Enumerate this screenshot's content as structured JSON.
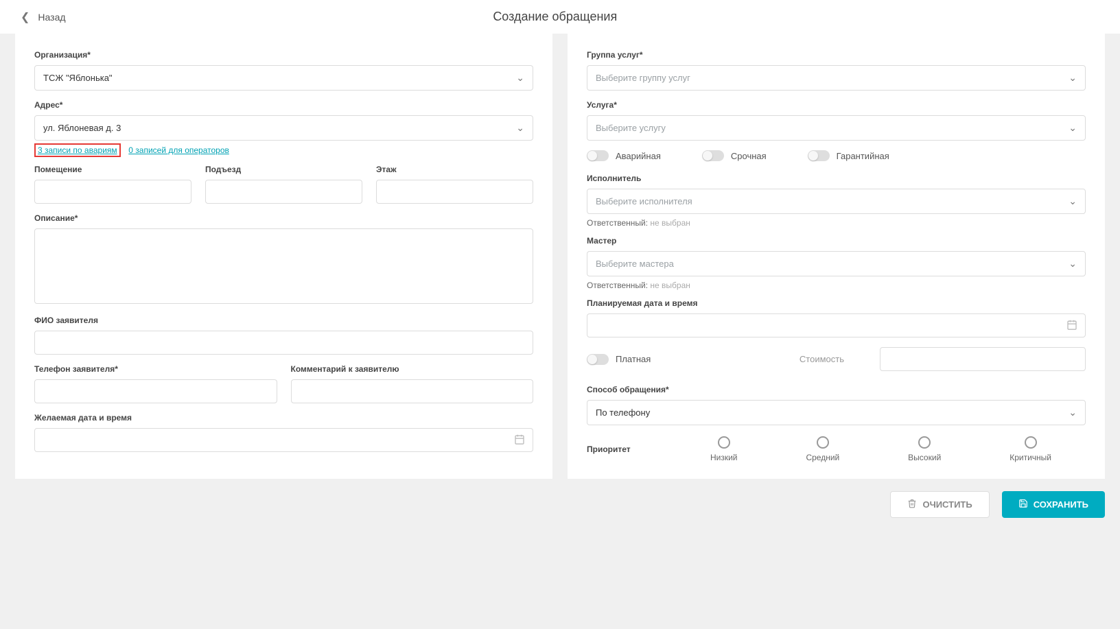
{
  "header": {
    "back": "Назад",
    "title": "Создание обращения"
  },
  "left": {
    "org_label": "Организация*",
    "org_value": "ТСЖ \"Яблонька\"",
    "addr_label": "Адрес*",
    "addr_value": "ул. Яблоневая д. 3",
    "link_accidents": "3 записи по авариям",
    "link_operators": "0 записей для операторов",
    "room_label": "Помещение",
    "entrance_label": "Подъезд",
    "floor_label": "Этаж",
    "desc_label": "Описание*",
    "fio_label": "ФИО заявителя",
    "phone_label": "Телефон заявителя*",
    "comment_label": "Комментарий к заявителю",
    "wishdate_label": "Желаемая дата и время"
  },
  "right": {
    "group_label": "Группа услуг*",
    "group_placeholder": "Выберите группу услуг",
    "service_label": "Услуга*",
    "service_placeholder": "Выберите услугу",
    "toggle_emergency": "Аварийная",
    "toggle_urgent": "Срочная",
    "toggle_warranty": "Гарантийная",
    "executor_label": "Исполнитель",
    "executor_placeholder": "Выберите исполнителя",
    "resp_label": "Ответственный:",
    "resp_value": "не выбран",
    "master_label": "Мастер",
    "master_placeholder": "Выберите мастера",
    "plandate_label": "Планируемая дата и время",
    "paid_label": "Платная",
    "cost_label": "Стоимость",
    "method_label": "Способ обращения*",
    "method_value": "По телефону",
    "priority_label": "Приоритет",
    "pri_low": "Низкий",
    "pri_mid": "Средний",
    "pri_high": "Высокий",
    "pri_crit": "Критичный"
  },
  "footer": {
    "clear": "ОЧИСТИТЬ",
    "save": "СОХРАНИТЬ"
  }
}
